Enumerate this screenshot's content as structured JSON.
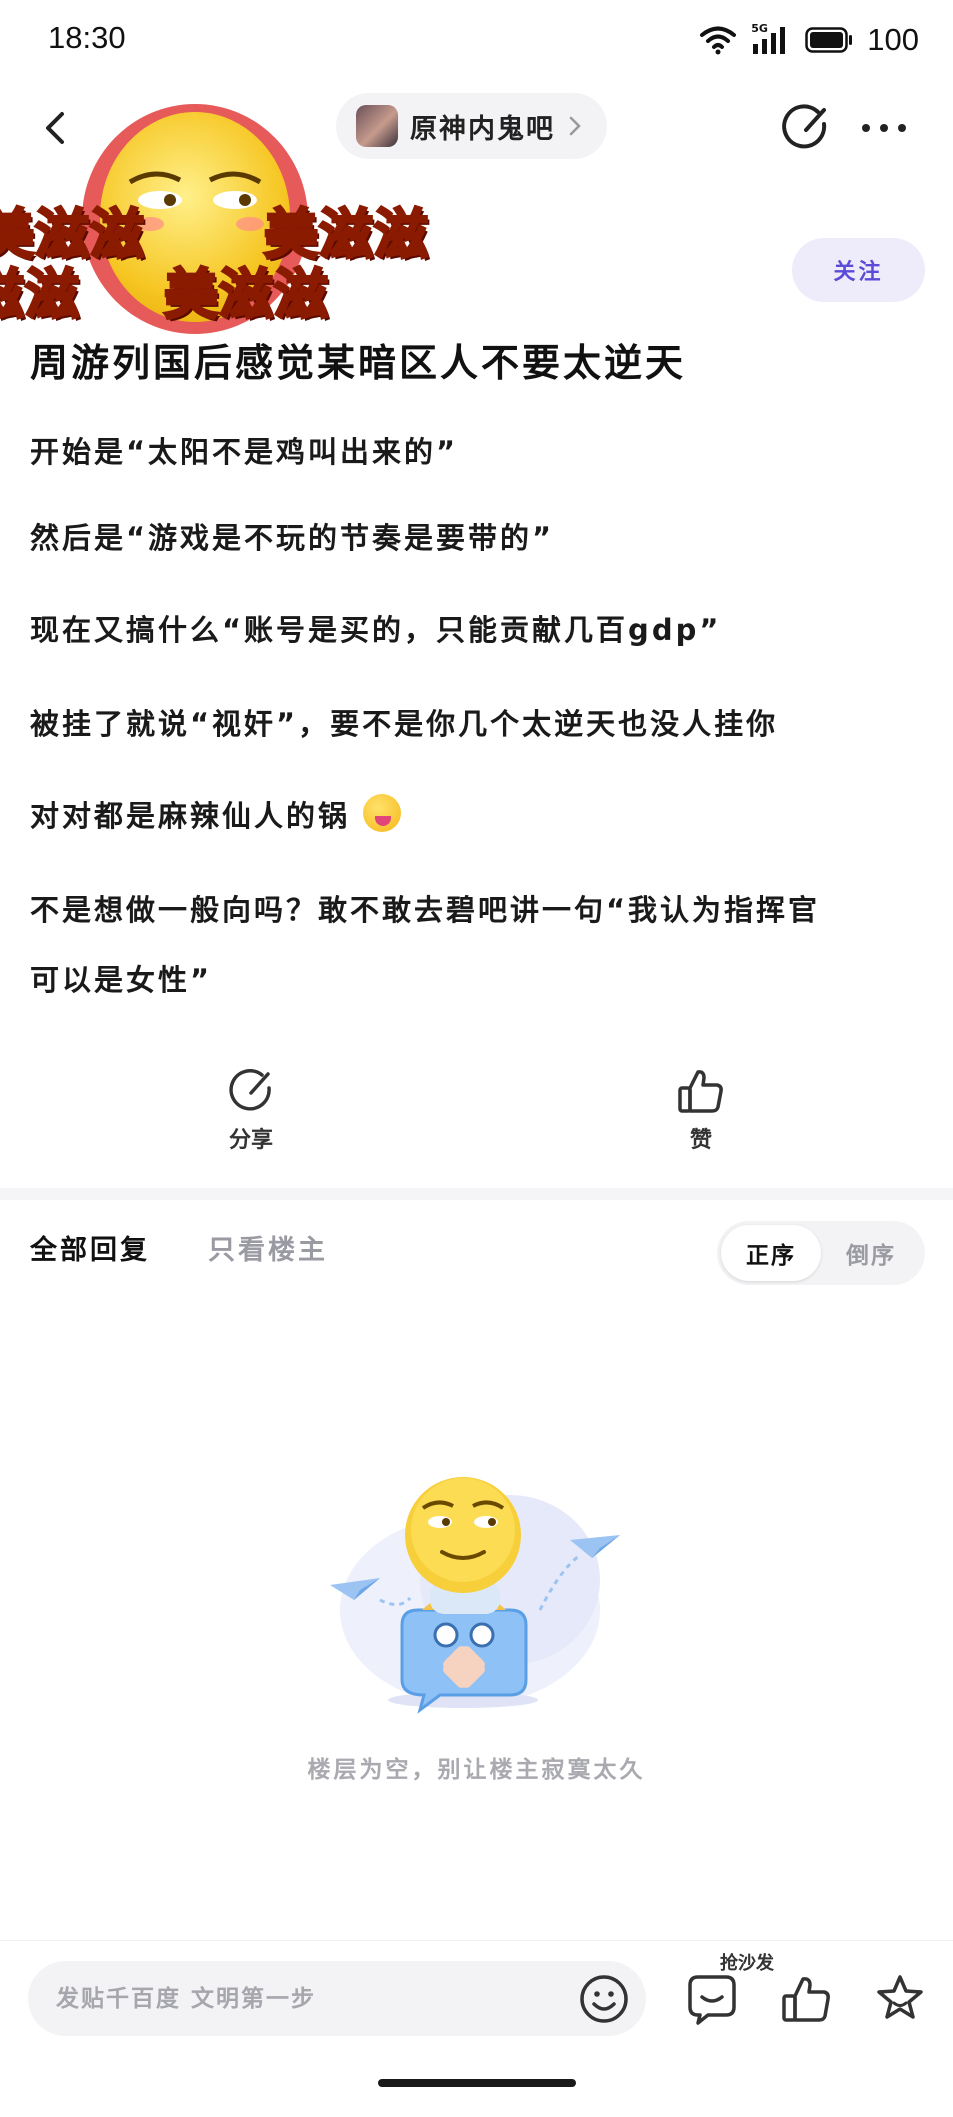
{
  "status_bar": {
    "time": "18:30",
    "network": "5G",
    "battery": "100"
  },
  "header": {
    "forum_name": "原神内鬼吧"
  },
  "sticker": {
    "line1": "美滋滋",
    "line2": "美滋滋",
    "line3": "滋滋",
    "line4": "美滋滋"
  },
  "follow_label": "关注",
  "post": {
    "title": "周游列国后感觉某暗区人不要太逆天",
    "lines": [
      "开始是“太阳不是鸡叫出来的”",
      "然后是“游戏是不玩的节奏是要带的”",
      "现在又搞什么“账号是买的，只能贡献几百gdp”",
      "被挂了就说“视奸”，要不是你几个太逆天也没人挂你",
      "对对都是麻辣仙人的锅",
      "不是想做一般向吗？敢不敢去碧吧讲一句“我认为指挥官",
      "可以是女性”"
    ]
  },
  "actions": {
    "share": "分享",
    "like": "赞"
  },
  "replies": {
    "tab_all": "全部回复",
    "tab_op": "只看楼主",
    "sort_asc": "正序",
    "sort_desc": "倒序",
    "empty_text": "楼层为空，别让楼主寂寞太久"
  },
  "bottom_bar": {
    "input_placeholder": "发贴千百度 文明第一步",
    "sofa_label": "抢沙发"
  },
  "colors": {
    "accent": "#5b4bd6",
    "follow_bg": "#eeecfb",
    "muted": "#a9a9b0"
  }
}
